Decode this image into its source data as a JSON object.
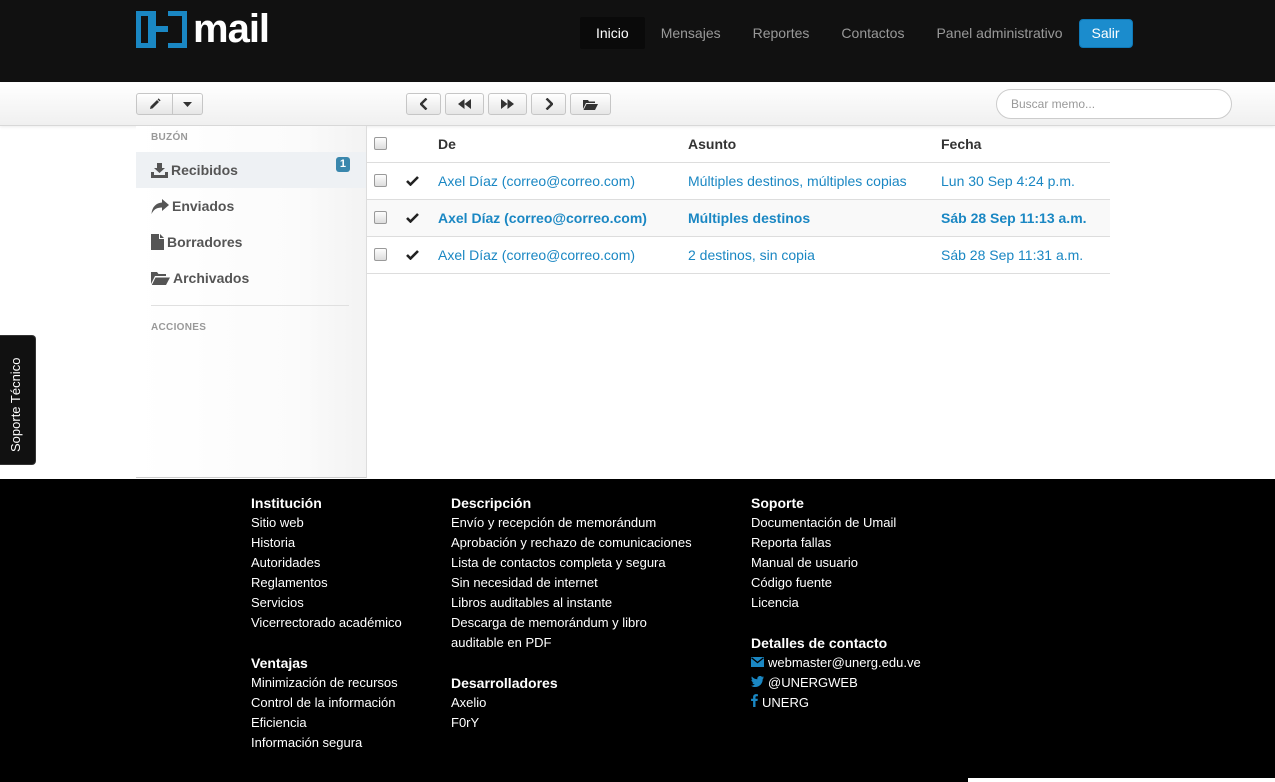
{
  "brand": {
    "logo_text": "mail"
  },
  "nav": {
    "items": [
      {
        "label": "Inicio",
        "active": true
      },
      {
        "label": "Mensajes",
        "active": false
      },
      {
        "label": "Reportes",
        "active": false
      },
      {
        "label": "Contactos",
        "active": false
      },
      {
        "label": "Panel administrativo",
        "active": false
      }
    ],
    "logout_label": "Salir"
  },
  "toolbar": {
    "search_placeholder": "Buscar memo..."
  },
  "sidebar": {
    "mailbox_header": "BUZÓN",
    "items": [
      {
        "label": "Recibidos",
        "icon": "download-icon",
        "badge": "1",
        "active": true
      },
      {
        "label": "Enviados",
        "icon": "share-icon",
        "active": false
      },
      {
        "label": "Borradores",
        "icon": "file-icon",
        "active": false
      },
      {
        "label": "Archivados",
        "icon": "folder-open-icon",
        "active": false
      }
    ],
    "actions_header": "ACCIONES"
  },
  "table": {
    "columns": [
      "De",
      "Asunto",
      "Fecha"
    ],
    "rows": [
      {
        "from": "Axel Díaz (correo@correo.com)",
        "subject": "Múltiples destinos, múltiples copias",
        "date": "Lun 30 Sep 4:24 p.m.",
        "unread": false
      },
      {
        "from": "Axel Díaz (correo@correo.com)",
        "subject": "Múltiples destinos",
        "date": "Sáb 28 Sep 11:13 a.m.",
        "unread": true
      },
      {
        "from": "Axel Díaz (correo@correo.com)",
        "subject": "2 destinos, sin copia",
        "date": "Sáb 28 Sep 11:31 a.m.",
        "unread": false
      }
    ]
  },
  "support_tab": "Soporte Técnico",
  "footer": {
    "institucion": {
      "title": "Institución",
      "links": [
        "Sitio web",
        "Historia",
        "Autoridades",
        "Reglamentos",
        "Servicios",
        "Vicerrectorado académico"
      ]
    },
    "ventajas": {
      "title": "Ventajas",
      "links": [
        "Minimización de recursos",
        "Control de la información",
        "Eficiencia",
        "Información segura"
      ]
    },
    "descripcion": {
      "title": "Descripción",
      "links": [
        "Envío y recepción de memorándum",
        "Aprobación y rechazo de comunicaciones",
        "Lista de contactos completa y segura",
        "Sin necesidad de internet",
        "Libros auditables al instante",
        "Descarga de memorándum y libro",
        "auditable en PDF"
      ]
    },
    "desarrolladores": {
      "title": "Desarrolladores",
      "links": [
        "Axelio",
        "F0rY"
      ]
    },
    "soporte": {
      "title": "Soporte",
      "links": [
        "Documentación de Umail",
        "Reporta fallas",
        "Manual de usuario",
        "Código fuente",
        "Licencia"
      ]
    },
    "contacto": {
      "title": "Detalles de contacto",
      "email": "webmaster@unerg.edu.ve",
      "twitter": "@UNERGWEB",
      "facebook": "UNERG"
    }
  },
  "colors": {
    "accent": "#1a87c3",
    "navbar": "#111111",
    "footer": "#000000",
    "badge": "#3a87ad"
  }
}
